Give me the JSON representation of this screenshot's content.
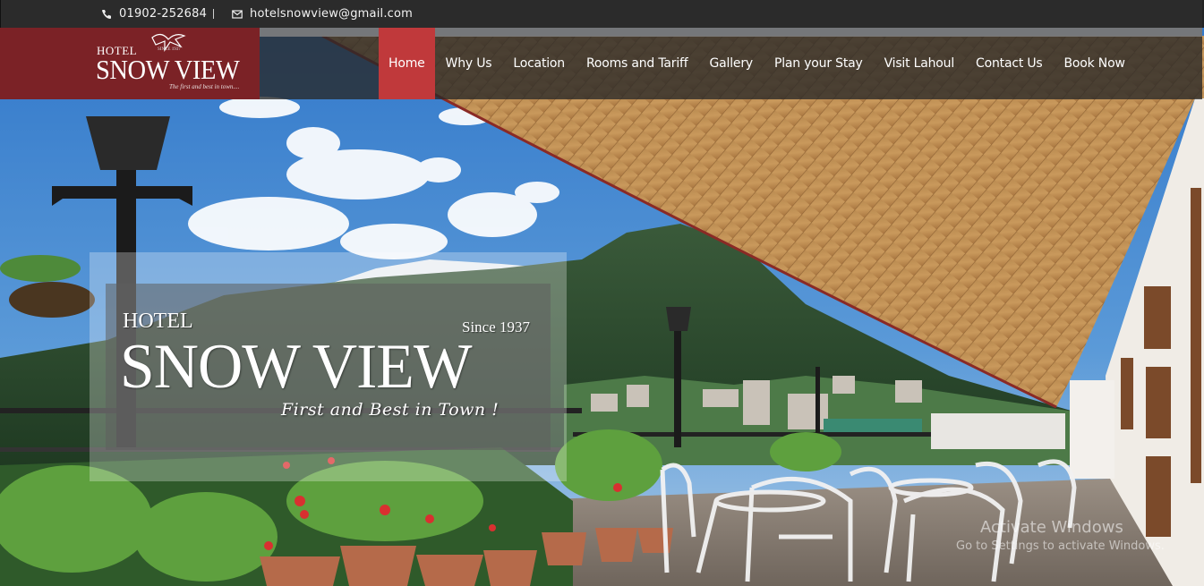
{
  "topbar": {
    "phone": "01902-252684",
    "email": "hotelsnowview@gmail.com",
    "phone_icon": "phone-icon",
    "email_icon": "envelope-icon"
  },
  "logo": {
    "hotel": "HOTEL",
    "since_small": "SINCE 1937",
    "name": "SNOW VIEW",
    "tagline": "The first and best in town...."
  },
  "nav": {
    "items": [
      {
        "label": "Home",
        "active": true
      },
      {
        "label": "Why Us"
      },
      {
        "label": "Location"
      },
      {
        "label": "Rooms and Tariff"
      },
      {
        "label": "Gallery"
      },
      {
        "label": "Plan your Stay"
      },
      {
        "label": "Visit Lahoul"
      },
      {
        "label": "Contact Us"
      },
      {
        "label": "Book Now"
      }
    ]
  },
  "hero": {
    "hotel": "HOTEL",
    "since": "Since 1937",
    "name": "SNOW VIEW",
    "tagline": "First and Best in Town !"
  },
  "watermark": {
    "title": "Activate Windows",
    "subtitle": "Go to Settings to activate Windows."
  },
  "colors": {
    "accent": "#c0393b",
    "logo_bg": "#7b2226",
    "topbar_bg": "#2b2b2b"
  }
}
